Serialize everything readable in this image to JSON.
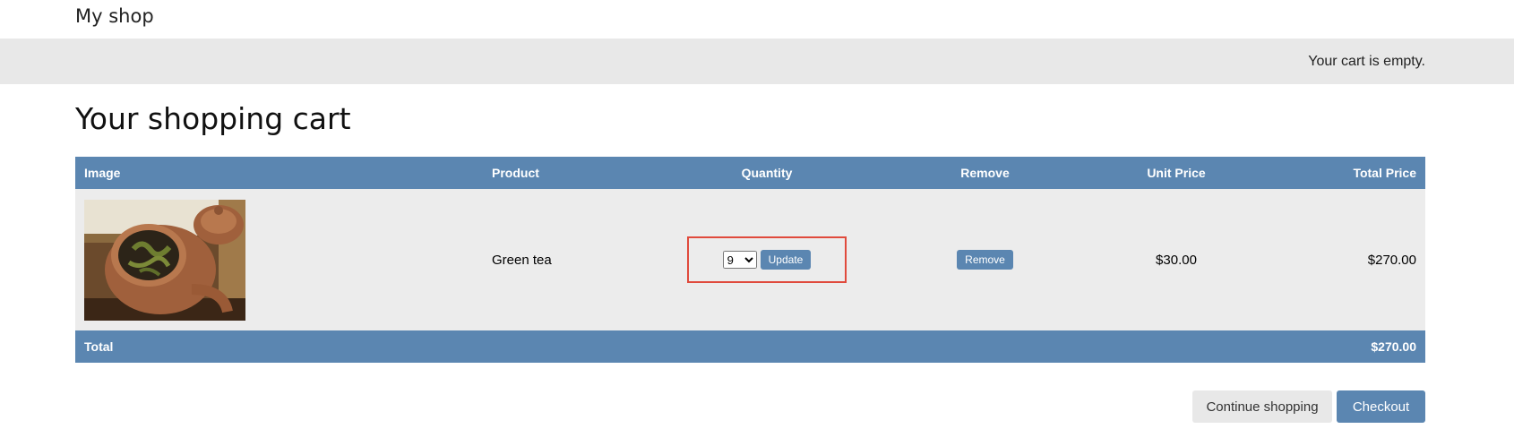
{
  "header": {
    "title": "My shop"
  },
  "cart_bar": {
    "status": "Your cart is empty."
  },
  "page": {
    "title": "Your shopping cart"
  },
  "table": {
    "headers": {
      "image": "Image",
      "product": "Product",
      "quantity": "Quantity",
      "remove": "Remove",
      "unit_price": "Unit Price",
      "total_price": "Total Price"
    },
    "rows": [
      {
        "image_icon": "teapot-image",
        "product": "Green tea",
        "quantity": "9",
        "update_label": "Update",
        "remove_label": "Remove",
        "unit_price": "$30.00",
        "total_price": "$270.00"
      }
    ],
    "footer": {
      "label": "Total",
      "total": "$270.00"
    }
  },
  "actions": {
    "continue_label": "Continue shopping",
    "checkout_label": "Checkout"
  },
  "colors": {
    "accent": "#5b86b1",
    "highlight": "#e04a3c",
    "bar": "#e8e8e8",
    "row": "#ececec"
  }
}
